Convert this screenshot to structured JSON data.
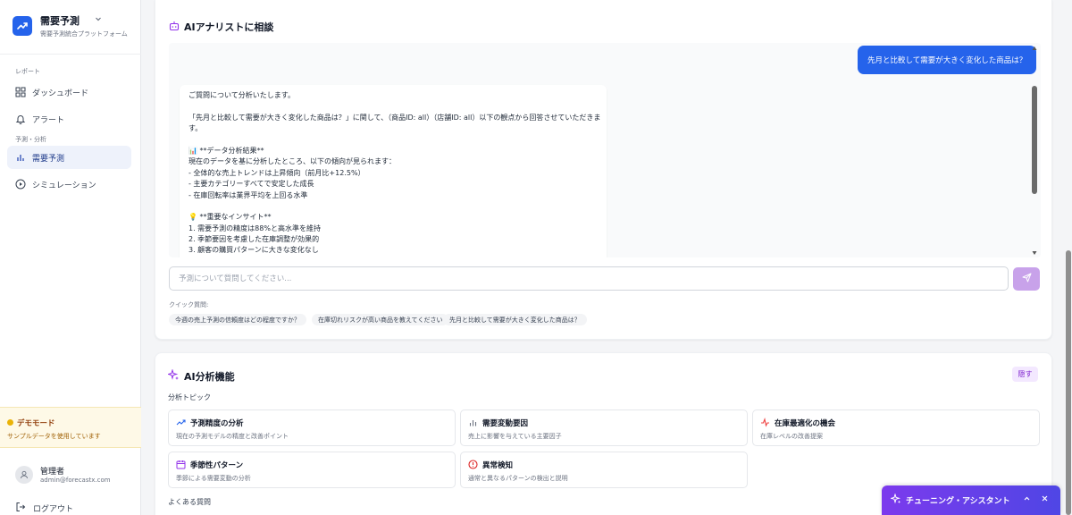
{
  "sidebar": {
    "brand_title": "需要予測",
    "brand_subtitle": "需要予測統合プラットフォーム",
    "section_report": "レポート",
    "section_forecast": "予測・分析",
    "items": [
      {
        "label": "ダッシュボード"
      },
      {
        "label": "アラート"
      },
      {
        "label": "需要予測"
      },
      {
        "label": "シミュレーション"
      }
    ],
    "demo_title": "デモモード",
    "demo_sub": "サンプルデータを使用しています",
    "user_name": "管理者",
    "user_email": "admin@forecastx.com",
    "logout": "ログアウト"
  },
  "chat": {
    "title": "AIアナリストに相談",
    "user_message": "先月と比較して需要が大きく変化した商品は？",
    "ai_lines": [
      "ご質問について分析いたします。",
      "",
      "「先月と比較して需要が大きく変化した商品は？」に関して、（商品ID: all）（店舗ID: all）以下の観点から回答させていただきま",
      "す。",
      "",
      "📊 **データ分析結果**",
      "現在のデータを基に分析したところ、以下の傾向が見られます：",
      "- 全体的な売上トレンドは上昇傾向（前月比+12.5%）",
      "- 主要カテゴリーすべてで安定した成長",
      "- 在庫回転率は業界平均を上回る水準",
      "",
      "💡 **重要なインサイト**",
      "1. 需要予測の精度は88%と高水準を維持",
      "2. 季節要因を考慮した在庫調整が効果的",
      "3. 顧客の購買パターンに大きな変化なし"
    ],
    "input_placeholder": "予測について質問してください...",
    "input_value": "",
    "quick_label": "クイック質問:",
    "quick_questions": [
      "今週の売上予測の信頼度はどの程度ですか？",
      "在庫切れリスクが高い商品を教えてください",
      "先月と比較して需要が大きく変化した商品は？"
    ]
  },
  "analysis": {
    "title": "AI分析機能",
    "hide_label": "隠す",
    "topics_label": "分析トピック",
    "topics": [
      {
        "title": "予測精度の分析",
        "desc": "現在の予測モデルの精度と改善ポイント",
        "icon": "trend-up-icon"
      },
      {
        "title": "需要変動要因",
        "desc": "売上に影響を与えている主要因子",
        "icon": "bar-chart-icon"
      },
      {
        "title": "在庫最適化の機会",
        "desc": "在庫レベルの改善提案",
        "icon": "activity-icon"
      },
      {
        "title": "季節性パターン",
        "desc": "季節による需要変動の分析",
        "icon": "calendar-icon"
      },
      {
        "title": "異常検知",
        "desc": "通常と異なるパターンの検出と説明",
        "icon": "alert-circle-icon"
      }
    ],
    "faq_label": "よくある質問"
  },
  "assistant": {
    "title": "チューニング・アシスタント"
  },
  "colors": {
    "primary": "#2563eb",
    "purple": "#7c3aed",
    "demo_bg": "#fef9e7"
  }
}
